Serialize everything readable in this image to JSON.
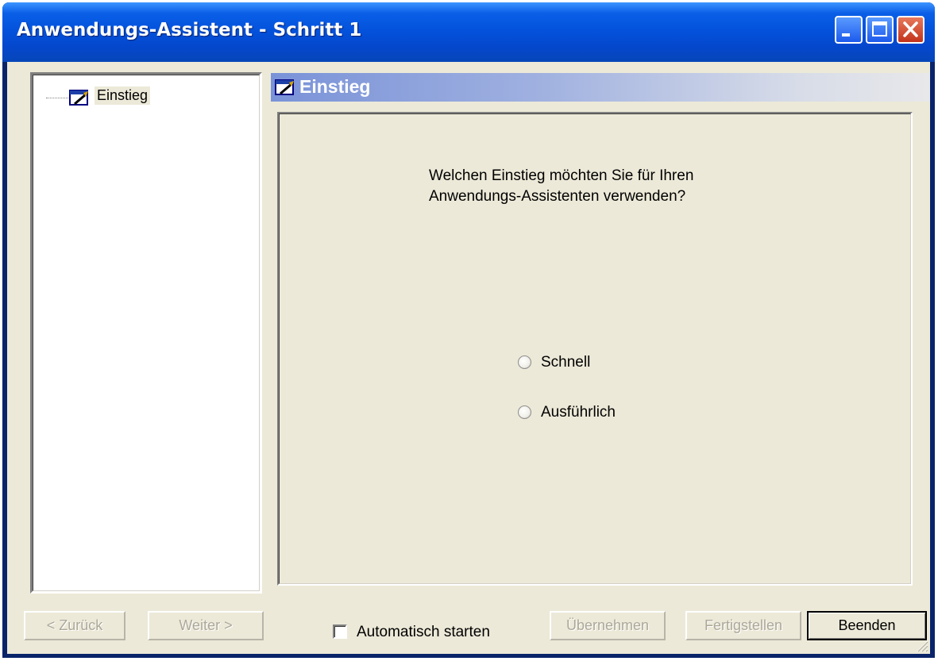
{
  "window": {
    "title": "Anwendungs-Assistent - Schritt 1",
    "controls": {
      "minimize_icon": "minimize-icon",
      "maximize_icon": "maximize-icon",
      "close_icon": "close-icon"
    },
    "colors": {
      "titlebar": "#0453dd",
      "close": "#c2331a",
      "face": "#ece9d8"
    }
  },
  "tree": {
    "items": [
      {
        "label": "Einstieg",
        "icon": "wizard-step-icon",
        "selected": true
      }
    ]
  },
  "section": {
    "title": "Einstieg",
    "icon": "wizard-step-icon"
  },
  "content": {
    "question_line1": "Welchen Einstieg möchten Sie für Ihren",
    "question_line2": "Anwendungs-Assistenten verwenden?",
    "options": [
      {
        "label": "Schnell",
        "selected": false
      },
      {
        "label": "Ausführlich",
        "selected": false
      }
    ]
  },
  "footer": {
    "back_label": "< Zurück",
    "next_label": "Weiter >",
    "autostart_label": "Automatisch starten",
    "autostart_checked": false,
    "apply_label": "Übernehmen",
    "finish_label": "Fertigstellen",
    "close_label": "Beenden"
  }
}
